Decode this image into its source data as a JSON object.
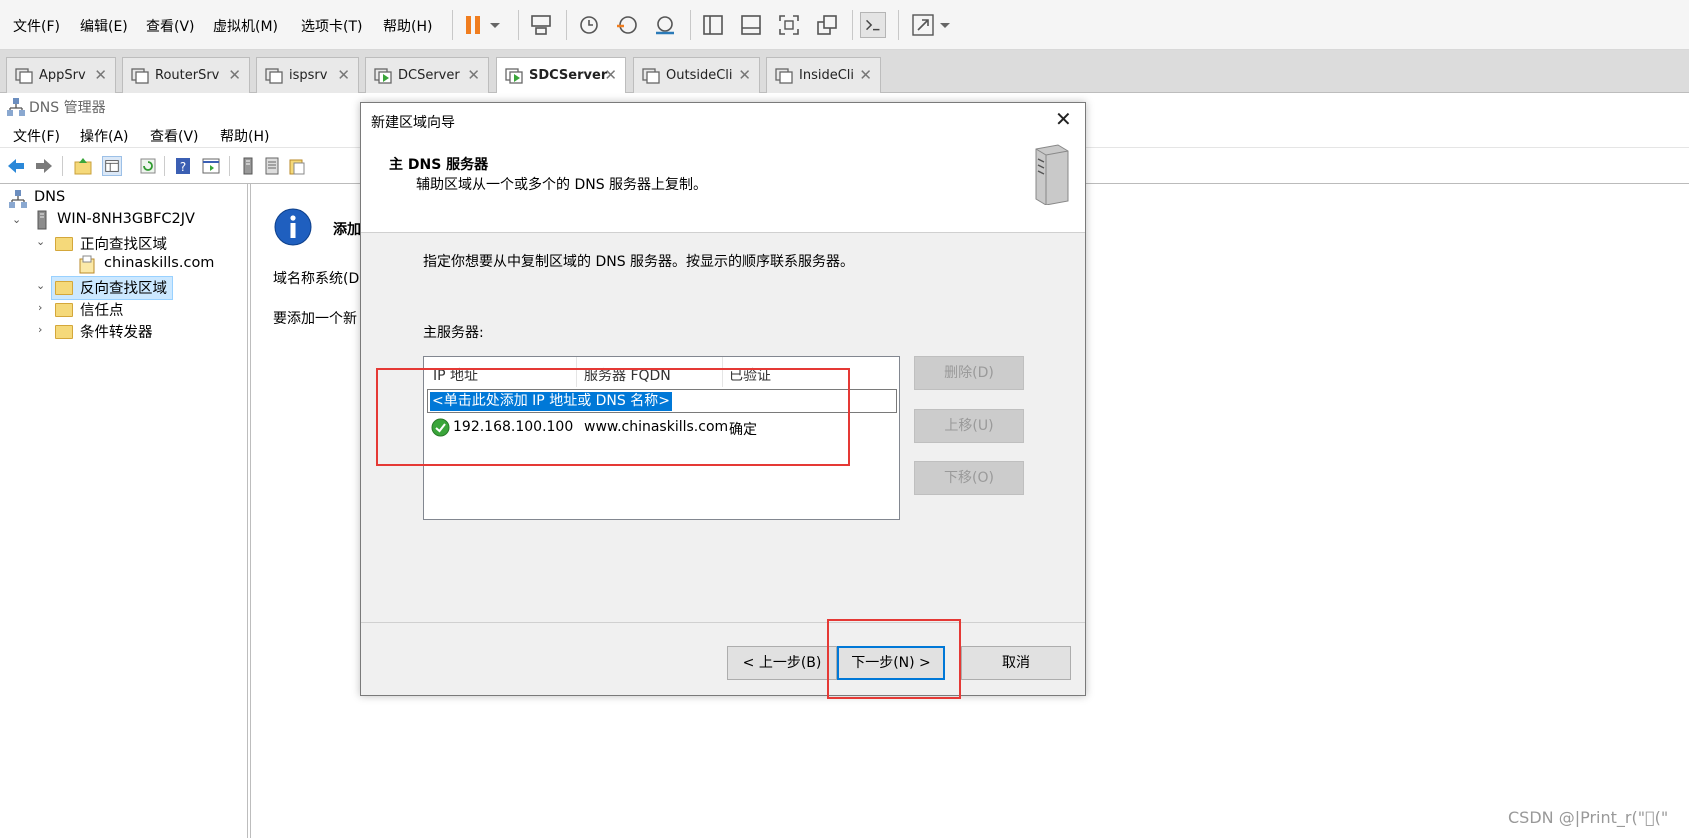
{
  "vm_menu": [
    "文件(F)",
    "编辑(E)",
    "查看(V)",
    "虚拟机(M)",
    "选项卡(T)",
    "帮助(H)"
  ],
  "vm_tabs": [
    {
      "label": "AppSrv",
      "active": false
    },
    {
      "label": "RouterSrv",
      "active": false
    },
    {
      "label": "ispsrv",
      "active": false
    },
    {
      "label": "DCServer",
      "active": false
    },
    {
      "label": "SDCServer",
      "active": true
    },
    {
      "label": "OutsideCli",
      "active": false
    },
    {
      "label": "InsideCli",
      "active": false
    }
  ],
  "dns": {
    "title": "DNS 管理器",
    "menu": [
      "文件(F)",
      "操作(A)",
      "查看(V)",
      "帮助(H)"
    ],
    "tree": {
      "root": "DNS",
      "server": "WIN-8NH3GBFC2JV",
      "forward": "正向查找区域",
      "forward_zone": "chinaskills.com",
      "reverse": "反向查找区域",
      "trust": "信任点",
      "forwarders": "条件转发器"
    },
    "content": {
      "heading": "添加",
      "line1": "域名称系统(D",
      "line2": "要添加一个新"
    }
  },
  "wizard": {
    "title": "新建区域向导",
    "header_title": "主 DNS 服务器",
    "header_sub": "辅助区域从一个或多个的 DNS 服务器上复制。",
    "instruction": "指定你想要从中复制区域的 DNS 服务器。按显示的顺序联系服务器。",
    "list_label": "主服务器:",
    "columns": [
      "IP 地址",
      "服务器 FQDN",
      "已验证"
    ],
    "add_placeholder": "<单击此处添加 IP 地址或 DNS 名称>",
    "row": {
      "ip": "192.168.100.100",
      "fqdn": "www.chinaskills.com",
      "status": "确定"
    },
    "side_buttons": {
      "delete": "删除(D)",
      "up": "上移(U)",
      "down": "下移(O)"
    },
    "buttons": {
      "back": "< 上一步(B)",
      "next": "下一步(N) >",
      "cancel": "取消"
    }
  },
  "watermark": "CSDN @|Print_r(\"\u0000(\"",
  "colors": {
    "selection": "#0078d7",
    "annotation": "#e53935",
    "pause": "#f07d1e"
  }
}
